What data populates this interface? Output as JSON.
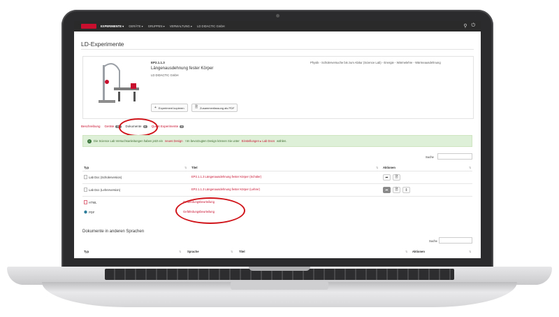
{
  "topbar": {
    "nav": [
      "EXPERIMENTE ▾",
      "GERÄTE ▾",
      "GRUPPEN ▾",
      "VERWALTUNG ▾",
      "LD DIDACTIC GmbH"
    ],
    "icons": [
      "search-icon",
      "power-icon"
    ]
  },
  "page": {
    "title": "LD-Experimente"
  },
  "experiment": {
    "id": "EP2.1.1.3",
    "title": "Längenausdehnung fester Körper",
    "company": "LD DIDACTIC GmbH",
    "category": "Physik - Schülerversuche bis zum Abitur (Science Lab) - Energie - Wärmelehre - Wärmeausdehnung",
    "buttons": {
      "copy": "Experiment kopieren",
      "pdf": "Zusammenfassung als PDF"
    }
  },
  "tabs": [
    {
      "label": "Beschreibung",
      "count": ""
    },
    {
      "label": "Geräte",
      "count": "28"
    },
    {
      "label": "Dokumente",
      "count": "4"
    },
    {
      "label": "Quest Experimente",
      "count": "0"
    }
  ],
  "alert": {
    "text_before": "Die Science Lab Versuchsanleitungen haben jetzt ein ",
    "link1": "neues Design",
    "text_mid": "! Im bevorzugten Design können Sie unter ",
    "link2": "Einstellungen ▸ Lab Docs",
    "text_after": " wählen."
  },
  "table1": {
    "search_label": "Suche",
    "headers": {
      "type": "Typ",
      "title": "Titel",
      "actions": "Aktionen"
    },
    "rows": [
      {
        "type": "Lab Doc (Schülerversion)",
        "title": "EP2.1.1.3 Längenausdehnung fester Körper (Schüler)"
      },
      {
        "type": "Lab Doc (Lehrerversion)",
        "title": "EP2.1.1.3 Längenausdehnung fester Körper (Lehrer)"
      },
      {
        "type": "HTML",
        "title": "Gefährdungsbeurteilung"
      },
      {
        "type": "PDF",
        "title": "Gefährdungsbeurteilung"
      }
    ]
  },
  "section2": {
    "title": "Dokumente in anderen Sprachen",
    "search_label": "Suche",
    "headers": {
      "type": "Typ",
      "language": "Sprache",
      "title": "Titel",
      "actions": "Aktionen"
    }
  }
}
